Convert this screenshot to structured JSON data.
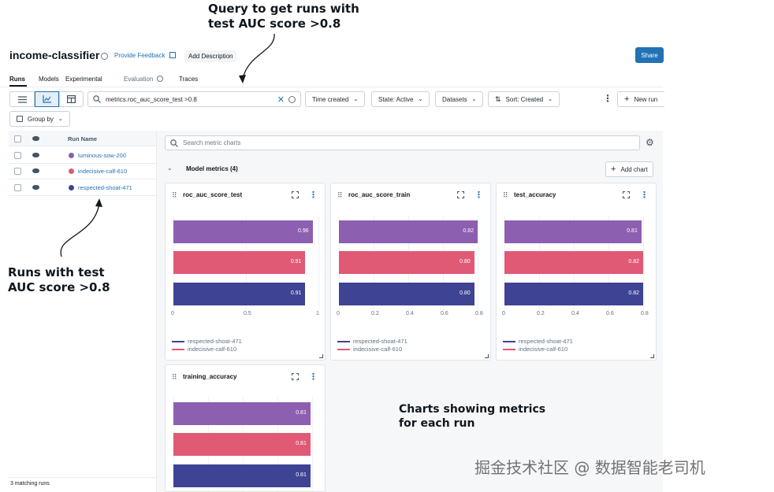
{
  "experiment": {
    "title": "income-classifier",
    "provide_feedback": "Provide Feedback",
    "add_description": "Add Description",
    "share": "Share"
  },
  "tabs": [
    {
      "label": "Runs"
    },
    {
      "label": "Models"
    },
    {
      "label": "Experimental"
    },
    {
      "label": "Evaluation"
    },
    {
      "label": "Traces"
    }
  ],
  "toolbar": {
    "search_value": "metrics.roc_auc_score_test >0.8",
    "time_created": "Time created",
    "state": "State: Active",
    "datasets": "Datasets",
    "sort": "Sort: Created",
    "new_run": "New run",
    "group_by": "Group by"
  },
  "runs_table": {
    "column_run_name": "Run Name",
    "runs": [
      {
        "name": "luminous-sow-200",
        "color": "#8c5fb0"
      },
      {
        "name": "indecisive-calf-610",
        "color": "#e05a76"
      },
      {
        "name": "respected-shoat-471",
        "color": "#3f4393"
      }
    ],
    "matching_runs": "3 matching runs"
  },
  "charts_panel": {
    "search_placeholder": "Search metric charts",
    "section_title": "Model metrics (4)",
    "add_chart": "Add chart"
  },
  "chart_data": [
    {
      "type": "bar",
      "title": "roc_auc_score_test",
      "categories": [
        "luminous-sow-200",
        "indecisive-calf-610",
        "respected-shoat-471"
      ],
      "values": [
        0.96,
        0.91,
        0.91
      ],
      "value_labels": [
        "0.96",
        "0.91",
        "0.91"
      ],
      "xticks": [
        "0",
        "0.5",
        "1"
      ],
      "xlim": [
        0,
        1
      ],
      "legend": [
        "respected-shoat-471",
        "indecisive-calf-610"
      ]
    },
    {
      "type": "bar",
      "title": "roc_auc_score_train",
      "categories": [
        "luminous-sow-200",
        "indecisive-calf-610",
        "respected-shoat-471"
      ],
      "values": [
        0.82,
        0.8,
        0.8
      ],
      "value_labels": [
        "0.82",
        "0.80",
        "0.80"
      ],
      "xticks": [
        "0",
        "0.2",
        "0.4",
        "0.6",
        "0.8"
      ],
      "xlim": [
        0,
        0.82
      ],
      "legend": [
        "respected-shoat-471",
        "indecisive-calf-610"
      ]
    },
    {
      "type": "bar",
      "title": "test_accuracy",
      "categories": [
        "luminous-sow-200",
        "indecisive-calf-610",
        "respected-shoat-471"
      ],
      "values": [
        0.81,
        0.82,
        0.82
      ],
      "value_labels": [
        "0.81",
        "0.82",
        "0.82"
      ],
      "xticks": [
        "0",
        "0.2",
        "0.4",
        "0.6",
        "0.8"
      ],
      "xlim": [
        0,
        0.82
      ],
      "legend": [
        "respected-shoat-471",
        "indecisive-calf-610"
      ]
    },
    {
      "type": "bar",
      "title": "training_accuracy",
      "categories": [
        "luminous-sow-200",
        "indecisive-calf-610",
        "respected-shoat-471"
      ],
      "values": [
        0.81,
        0.81,
        0.81
      ],
      "value_labels": [
        "0.81",
        "0.81",
        "0.81"
      ],
      "xticks": [],
      "xlim": [
        0,
        0.82
      ],
      "legend": []
    }
  ],
  "annotations": {
    "query_line1": "Query to get runs with",
    "query_line2": "test AUC score >0.8",
    "runs_line1": "Runs with test",
    "runs_line2": "AUC score >0.8",
    "charts_line1": "Charts showing metrics",
    "charts_line2": "for each run"
  },
  "watermark": "掘金技术社区 @ 数据智能老司机"
}
